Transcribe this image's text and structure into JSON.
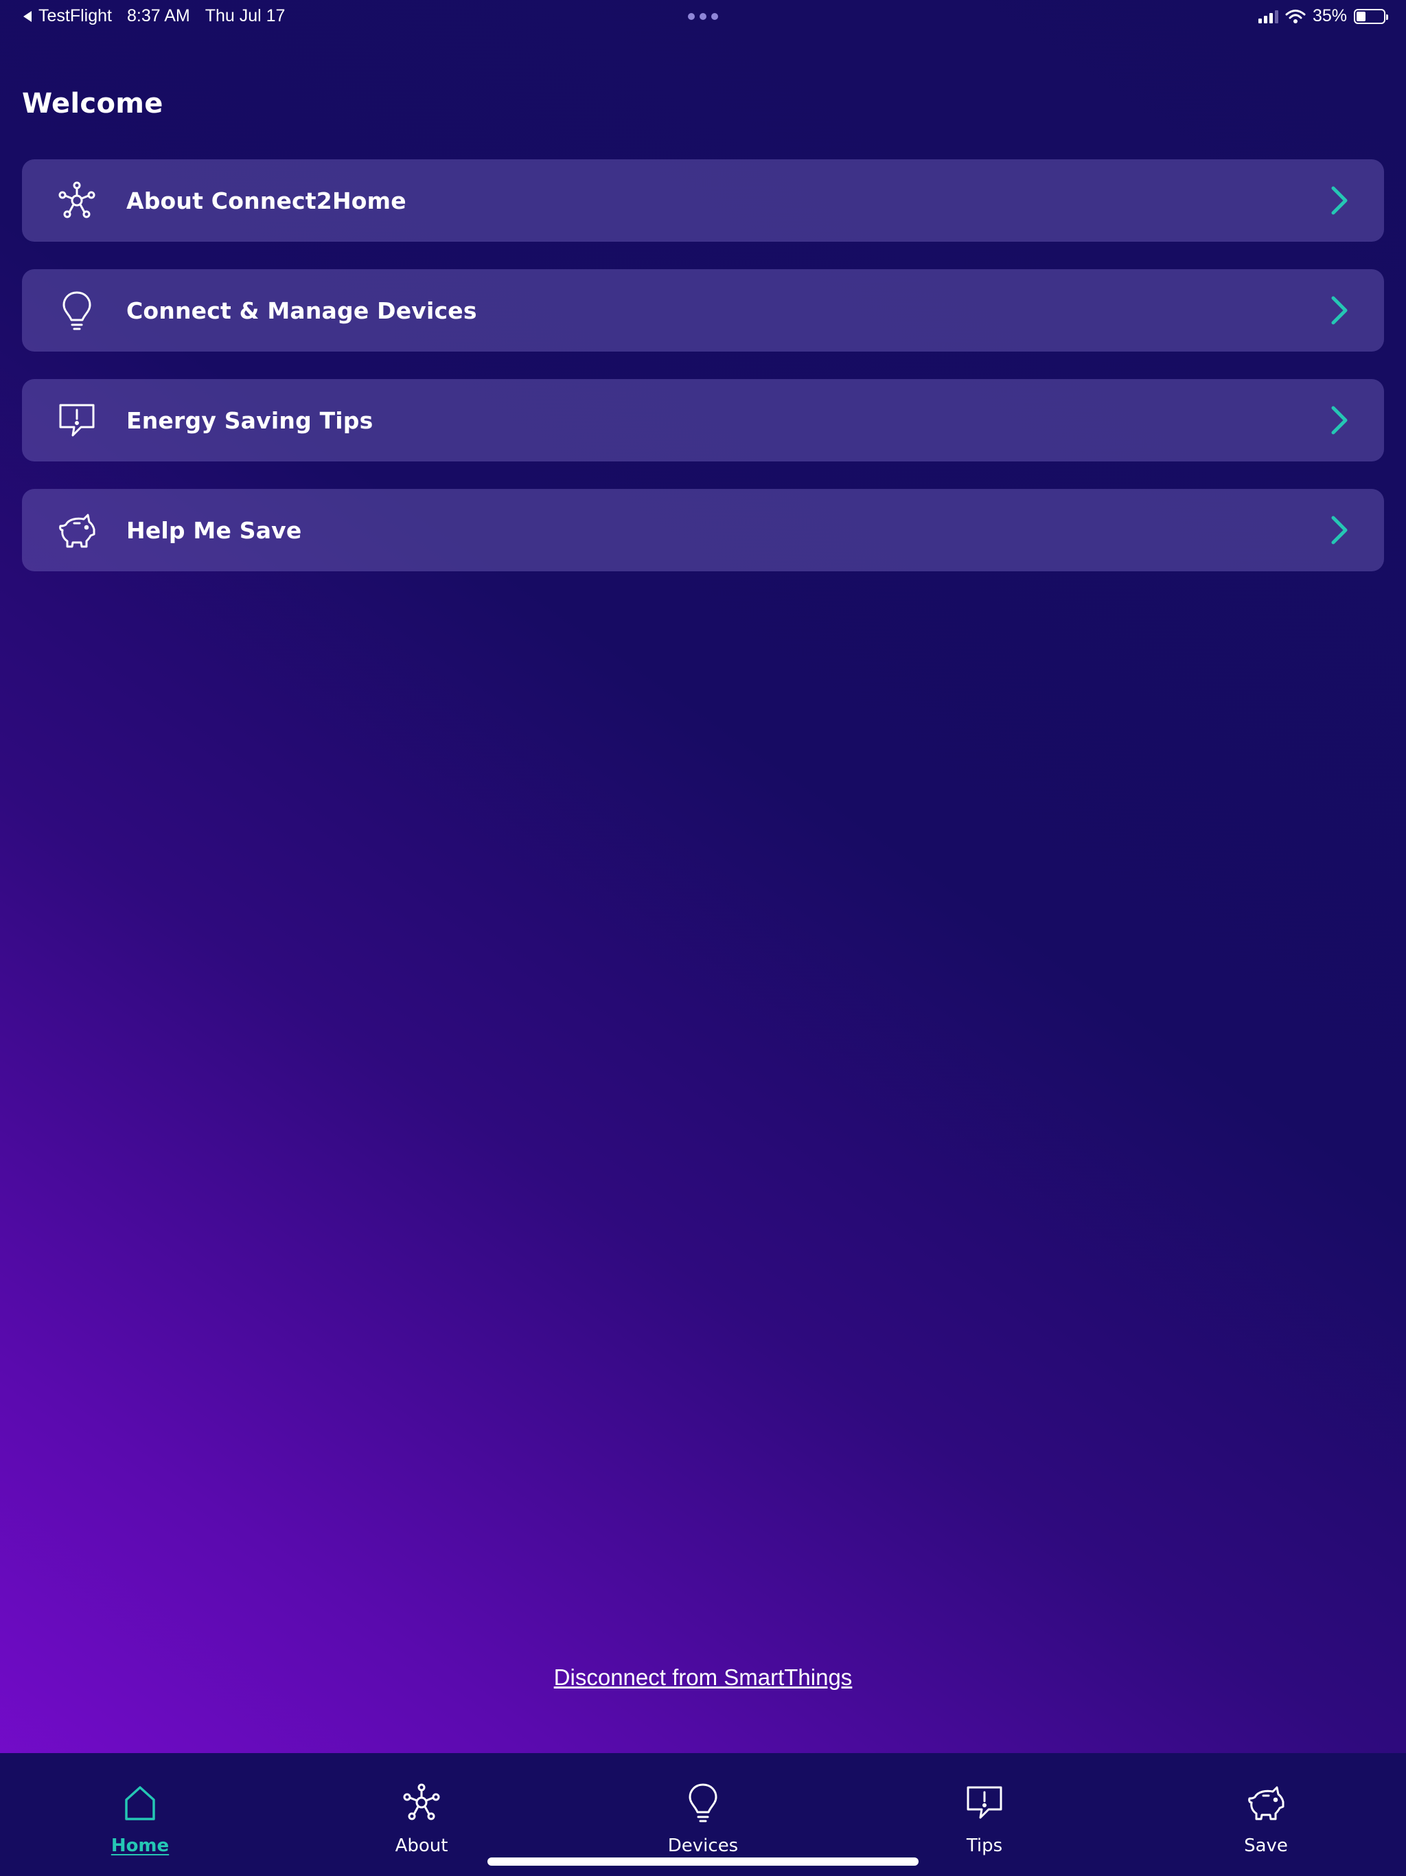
{
  "status_bar": {
    "back_app": "TestFlight",
    "time": "8:37 AM",
    "date": "Thu Jul 17",
    "battery_percent": "35%",
    "battery_level": 0.35
  },
  "header": {
    "title": "Welcome"
  },
  "menu": {
    "items": [
      {
        "label": "About Connect2Home",
        "icon": "network-hub-icon"
      },
      {
        "label": "Connect & Manage Devices",
        "icon": "lightbulb-icon"
      },
      {
        "label": "Energy Saving Tips",
        "icon": "alert-chat-icon"
      },
      {
        "label": "Help Me Save",
        "icon": "piggy-bank-icon"
      }
    ]
  },
  "disconnect_link": "Disconnect from SmartThings",
  "tabbar": {
    "active": "Home",
    "items": [
      {
        "label": "Home",
        "icon": "home-icon"
      },
      {
        "label": "About",
        "icon": "network-hub-icon"
      },
      {
        "label": "Devices",
        "icon": "lightbulb-icon"
      },
      {
        "label": "Tips",
        "icon": "alert-chat-icon"
      },
      {
        "label": "Save",
        "icon": "piggy-bank-icon"
      }
    ]
  },
  "colors": {
    "accent": "#25c7b4",
    "background_dark": "#150c60",
    "background_purple": "#7a0cd0",
    "card": "#3f3a7e",
    "text": "#ffffff"
  }
}
